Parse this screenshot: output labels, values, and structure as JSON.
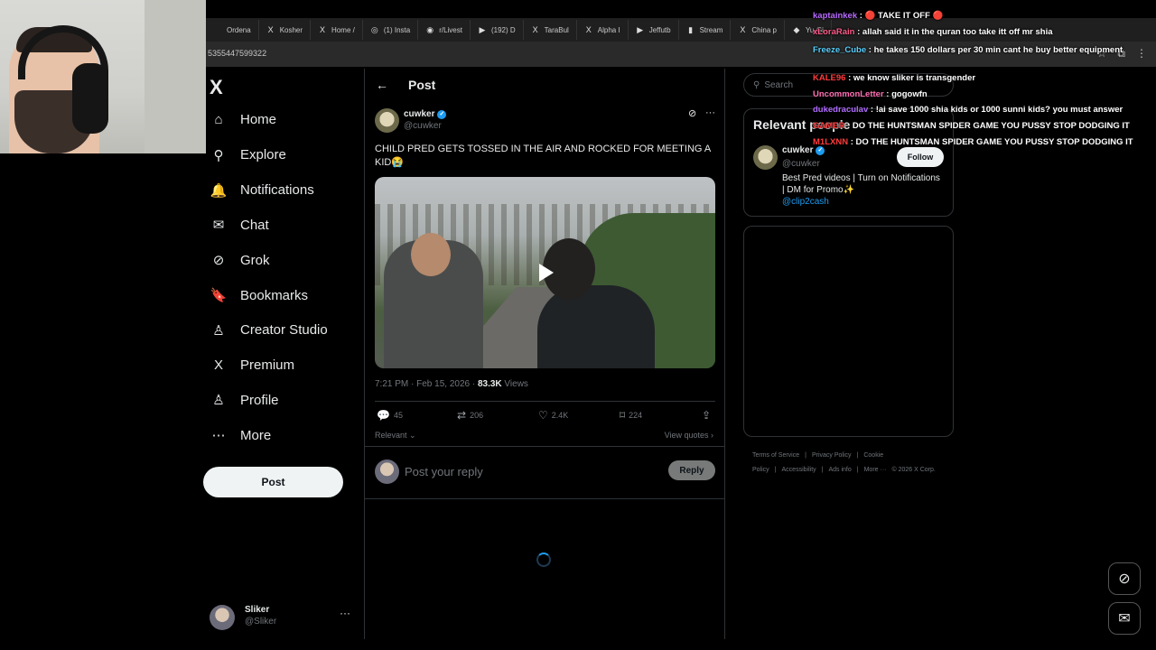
{
  "browser": {
    "tabs": [
      {
        "icon": "",
        "label": "Ordena"
      },
      {
        "icon": "X",
        "label": "Kosher"
      },
      {
        "icon": "X",
        "label": "Home /"
      },
      {
        "icon": "◎",
        "label": "(1) Insta"
      },
      {
        "icon": "◉",
        "label": "r/Livest"
      },
      {
        "icon": "▶",
        "label": "(192) D"
      },
      {
        "icon": "X",
        "label": "TaraBul"
      },
      {
        "icon": "X",
        "label": "Alpha I"
      },
      {
        "icon": "▶",
        "label": "Jeffutb"
      },
      {
        "icon": "▮",
        "label": "Stream"
      },
      {
        "icon": "X",
        "label": "China p"
      },
      {
        "icon": "◆",
        "label": "Yu-Gi"
      }
    ],
    "url_fragment": "5355447599322"
  },
  "nav": {
    "logo": "X",
    "items": [
      {
        "label": "Home",
        "icon": "⌂"
      },
      {
        "label": "Explore",
        "icon": "⚲"
      },
      {
        "label": "Notifications",
        "icon": "🔔"
      },
      {
        "label": "Chat",
        "icon": "✉"
      },
      {
        "label": "Grok",
        "icon": "⊘"
      },
      {
        "label": "Bookmarks",
        "icon": "🔖"
      },
      {
        "label": "Creator Studio",
        "icon": "♙"
      },
      {
        "label": "Premium",
        "icon": "X"
      },
      {
        "label": "Profile",
        "icon": "♙"
      },
      {
        "label": "More",
        "icon": "⋯"
      }
    ],
    "post_button": "Post",
    "account": {
      "name": "Sliker",
      "handle": "@Sliker",
      "more": "···"
    }
  },
  "post": {
    "header_title": "Post",
    "author_name": "cuwker",
    "author_handle": "@cuwker",
    "text": "CHILD PRED GETS TOSSED IN THE AIR AND ROCKED FOR MEETING A KID😭",
    "time": "7:21 PM · Feb 15, 2026 · ",
    "views_count": "83.3K",
    "views_label": " Views",
    "replies": "45",
    "reposts": "206",
    "likes": "2.4K",
    "bookmarks": "224",
    "relevant_label": "Relevant",
    "view_quotes_label": "View quotes",
    "reply_placeholder": "Post your reply",
    "reply_button": "Reply"
  },
  "right": {
    "search_placeholder": "Search",
    "relevant_title": "Relevant people",
    "person": {
      "name": "cuwker",
      "handle": "@cuwker",
      "bio": "Best Pred videos | Turn on Notifications | DM for Promo✨",
      "link": "@clip2cash",
      "follow_label": "Follow"
    },
    "footer": [
      "Terms of Service",
      "|",
      "Privacy Policy",
      "|",
      "Cookie Policy",
      "|",
      "Accessibility",
      "|",
      "Ads info",
      "|",
      "More ···",
      "© 2026 X Corp."
    ]
  },
  "chat": [
    {
      "user": "kaptainkek",
      "color": "#b86bff",
      "message": "🔴 TAKE IT OFF 🔴"
    },
    {
      "user": "xLoraRain",
      "color": "#ff5b8a",
      "message": "allah said it in the quran too take itt off mr shia"
    },
    {
      "user": "Freeze_Cube",
      "color": "#5ad1ff",
      "message": "he takes 150 dollars per 30 min cant he buy better equipment"
    },
    {
      "user": "KALE96",
      "color": "#ff3b3b",
      "message": "we know sliker is transgender"
    },
    {
      "user": "UncommonLetter",
      "color": "#ff6fb3",
      "message": "gogowfn"
    },
    {
      "user": "dukedraculav",
      "color": "#b06bff",
      "message": "!ai save 1000 shia kids or 1000 sunni kids? you must answer"
    },
    {
      "user": "GAMER",
      "color": "#ff3b3b",
      "message": "DO THE HUNTSMAN SPIDER GAME YOU PUSSY STOP DODGING IT"
    },
    {
      "user": "M1LXNN",
      "color": "#ff3b3b",
      "message": "DO THE HUNTSMAN SPIDER GAME YOU PUSSY STOP DODGING IT"
    }
  ],
  "colors": {
    "accent": "#1d9bf0",
    "background": "#000000",
    "border": "#2f3336",
    "muted": "#71767b"
  }
}
